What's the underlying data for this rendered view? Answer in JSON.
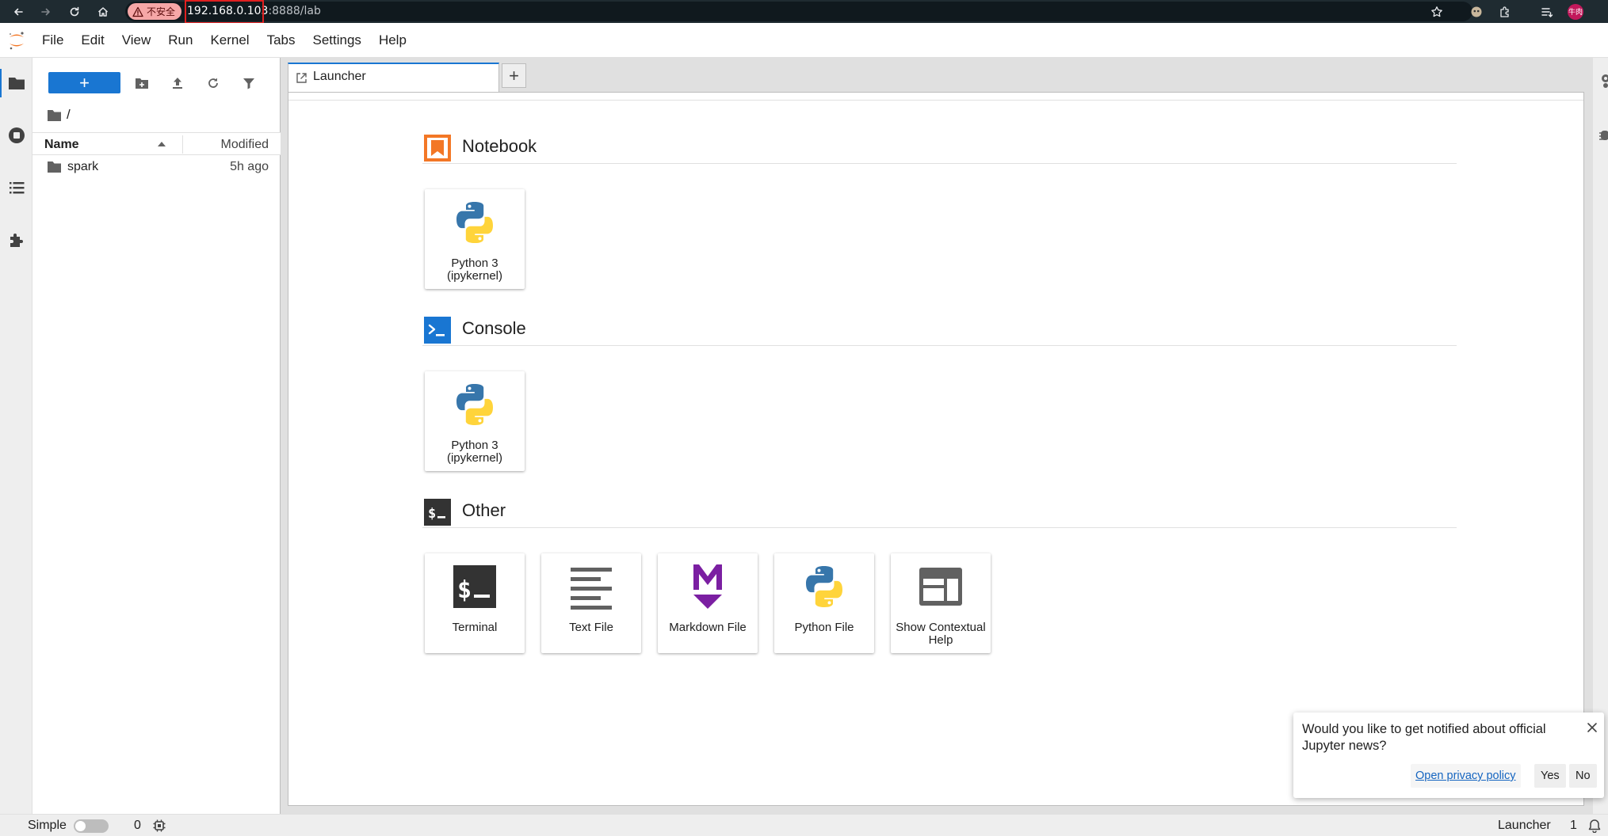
{
  "browser": {
    "insecure_label": "不安全",
    "url_host": "192.168.0.103",
    "url_rest": ":8888/lab",
    "profile_label": "牛肉"
  },
  "menubar": {
    "items": [
      "File",
      "Edit",
      "View",
      "Run",
      "Kernel",
      "Tabs",
      "Settings",
      "Help"
    ]
  },
  "filebrowser": {
    "new_label": "+",
    "breadcrumb": "/",
    "columns": {
      "name": "Name",
      "modified": "Modified"
    },
    "rows": [
      {
        "name": "spark",
        "modified": "5h ago"
      }
    ]
  },
  "tabs": {
    "active_label": "Launcher",
    "add_label": "+"
  },
  "launcher": {
    "sections": [
      {
        "title": "Notebook",
        "cards": [
          {
            "label": "Python 3 (ipykernel)"
          }
        ]
      },
      {
        "title": "Console",
        "cards": [
          {
            "label": "Python 3 (ipykernel)"
          }
        ]
      },
      {
        "title": "Other",
        "cards": [
          {
            "label": "Terminal"
          },
          {
            "label": "Text File"
          },
          {
            "label": "Markdown File"
          },
          {
            "label": "Python File"
          },
          {
            "label": "Show Contextual Help"
          }
        ]
      }
    ]
  },
  "notification": {
    "message": "Would you like to get notified about official Jupyter news?",
    "privacy_link": "Open privacy policy",
    "yes": "Yes",
    "no": "No"
  },
  "statusbar": {
    "mode_label": "Simple",
    "kernel_count": "0",
    "active_label": "Launcher",
    "notification_count": "1"
  },
  "colors": {
    "accent": "#1976d2",
    "notebook_icon": "#f37726",
    "console_icon": "#1976d2",
    "markdown_icon": "#7b1fa2"
  }
}
